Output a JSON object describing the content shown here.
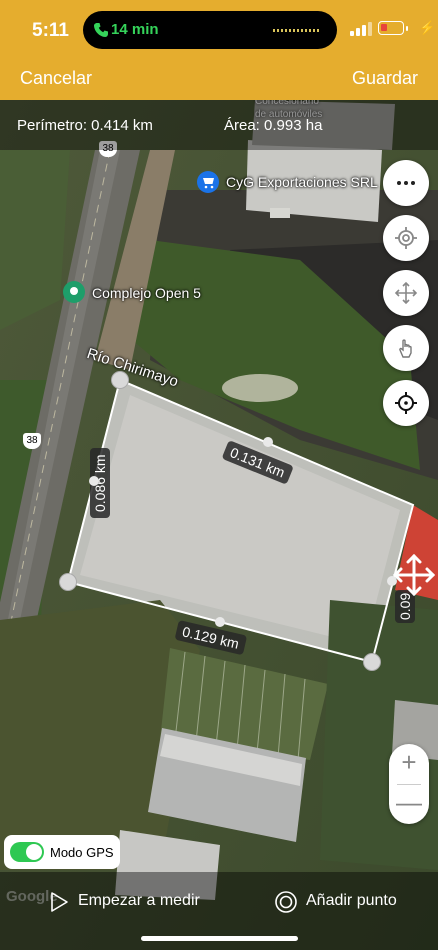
{
  "status": {
    "time": "5:11",
    "call_duration": "14 min",
    "battery_charging": "⚡"
  },
  "nav": {
    "cancel": "Cancelar",
    "save": "Guardar"
  },
  "measure": {
    "perimeter": "Perímetro: 0.414 km",
    "area": "Área: 0.993 ha"
  },
  "map": {
    "pois": [
      {
        "name": "CyG Exportaciones SRL",
        "icon": "shopping-cart-icon"
      },
      {
        "name": "Complejo Open 5",
        "icon": "location-pin-icon"
      }
    ],
    "partial_poi": "de automóviles",
    "partial_poi_top": "Concesionario",
    "road_shields": [
      "38",
      "38"
    ],
    "river": "Río Chirimayo",
    "polygon_edges": [
      "0.131 km",
      "0.086 km",
      "0.129 km",
      "0.09"
    ],
    "attribution": "Google"
  },
  "controls": {
    "more": "more-icon",
    "gps_target": "gps-icon",
    "move": "move-icon",
    "touch": "touch-icon",
    "crosshair": "crosshair-icon",
    "zoom_in": "+",
    "zoom_out": "—"
  },
  "gps_mode": {
    "label": "Modo GPS",
    "enabled": true
  },
  "bottom": {
    "start": "Empezar a medir",
    "add_point": "Añadir punto"
  },
  "colors": {
    "accent": "#e5ad2e",
    "toggle_on": "#2ec852",
    "call_green": "#35d35a"
  }
}
